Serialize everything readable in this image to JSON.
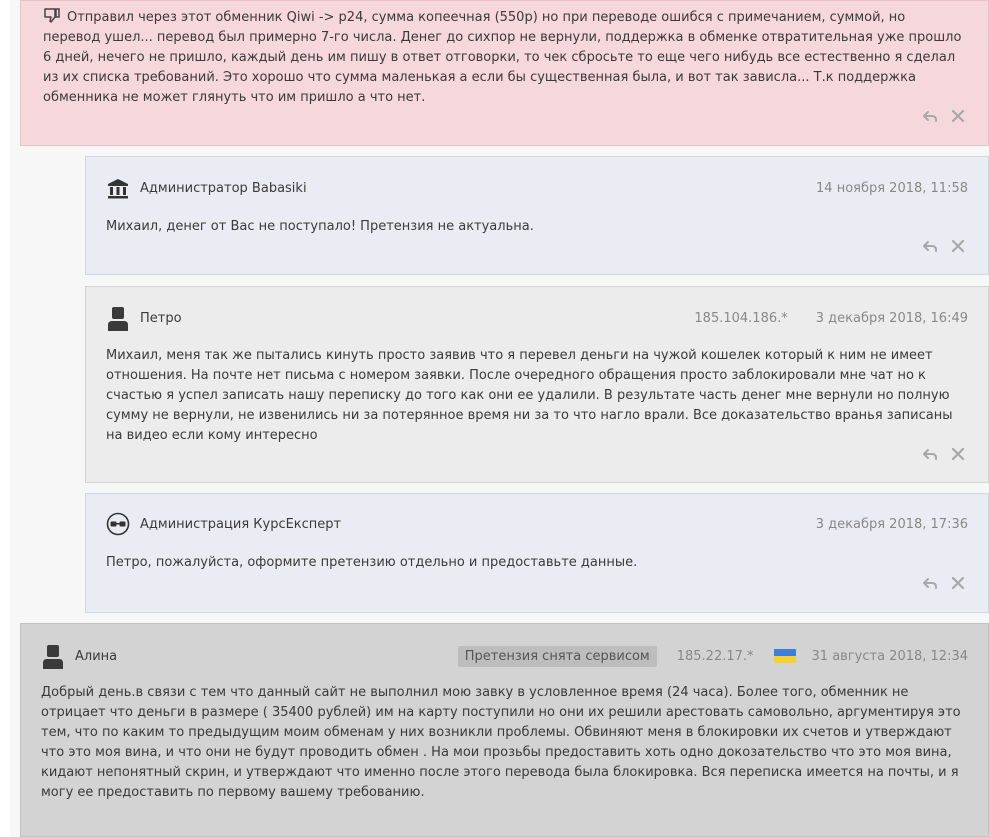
{
  "complaint": {
    "text": "Отправил через этот обменник Qiwi -> p24, сумма копеечная (550р) но при переводе ошибся с примечанием, суммой, но перевод ушел... перевод был примерно 7-го числа. Денег до сихпор не вернули, поддержка в обменке отвратительная уже прошло 6 дней, нечего не пришло, каждый день им пишу в ответ отговорки, то чек сбросьте то еще чего нибудь все естественно я сделал из их списка требований. Это хорошо что сумма маленькая а если бы существенная была, и вот так зависла... Т.к поддержка обменника не может глянуть что им пришло а что нет.",
    "icon": "thumbs-down-icon"
  },
  "thread": [
    {
      "author": "Администратор Babasiki",
      "avatar": "bank-icon",
      "date": "14 ноября 2018, 11:58",
      "text": "Михаил, денег от Вас не поступало! Претензия не актуальна."
    },
    {
      "author": "Петро",
      "avatar": "user-icon",
      "ip": "185.104.186.*",
      "date": "3 декабря 2018, 16:49",
      "text": "Михаил, меня так же пытались кинуть просто заявив что я перевел деньги на чужой кошелек который к ним не имеет отношения. На почте нет письма с номером заявки. После очередного обращения просто заблокировали мне чат но к счастью я успел записать нашу переписку до того как они ее удалили. В результате часть денег мне вернули но полную сумму не вернули, не извенились ни за потерянное время ни за то что нагло врали. Все доказательство вранья записаны на видео если кому интересно"
    },
    {
      "author": "Администрация КурсЕксперт",
      "avatar": "glasses-icon",
      "date": "3 декабря 2018, 17:36",
      "text": "Петро, пожалуйста, оформите претензию отдельно и предоставьте данные."
    }
  ],
  "review": {
    "author": "Алина",
    "avatar": "user-icon",
    "badge": "Претензия снята сервисом",
    "ip": "185.22.17.*",
    "flag": "ukraine-flag",
    "date": "31 августа 2018, 12:34",
    "text": "Добрый день.в связи с тем что данный сайт не выполнил мою завку в условленное время (24 часа). Более того, обменник не отрицает что деньги в размере ( 35400 рублей) им на карту поступили но они их решили арестовать самовольно, аргументируя это тем, что по каким то предыдущим моим обменам у них возникли проблемы. Обвиняют меня в блокировки их счетов и утверждают что это моя вина, и что они не будут проводить обмен . На мои прозьбы предоставить хоть одно докозательство что это моя вина, кидают непонятный скрин, и утверждают что именно после этого перевода была блокировка. Вся переписка имеется на почты, и я могу ее предоставить по первому вашему требованию."
  },
  "actions": {
    "reply_icon": "reply-icon",
    "close_icon": "close-icon"
  }
}
